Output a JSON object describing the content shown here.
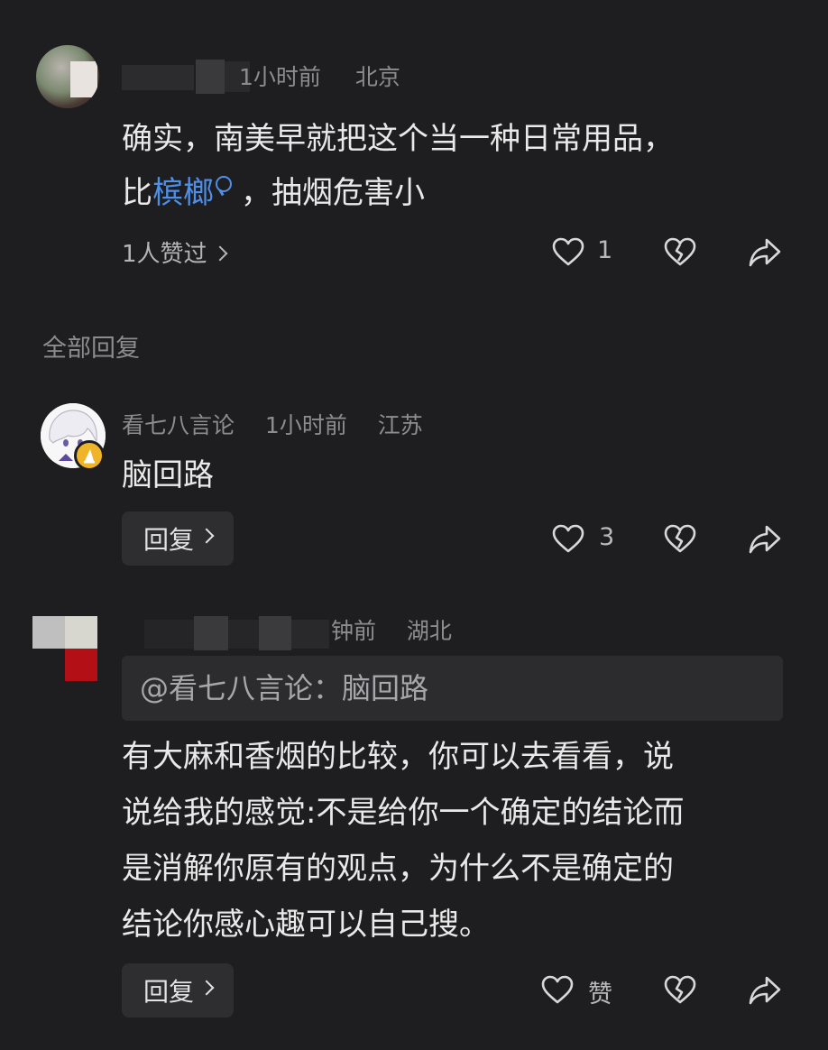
{
  "comment_top": {
    "time": "1小时前",
    "location": "北京",
    "text_line1": "确实，南美早就把这个当一种日常用品，",
    "text_prefix": "比",
    "link_word": "槟榔",
    "text_suffix": "，抽烟危害小",
    "likes_summary": "1人赞过",
    "like_count": "1"
  },
  "section": {
    "title": "全部回复"
  },
  "reply_1": {
    "author": "看七八言论",
    "time": "1小时前",
    "location": "江苏",
    "text": "脑回路",
    "reply_label": "回复",
    "like_count": "3"
  },
  "reply_2": {
    "time_partial": "钟前",
    "location": "湖北",
    "quote": "@看七八言论：脑回路",
    "text_lines": [
      "有大麻和香烟的比较，你可以去看看，说",
      "说给我的感觉:不是给你一个确定的结论而",
      "是消解你原有的观点，为什么不是确定的",
      "结论你感心趣可以自己搜。"
    ],
    "reply_label": "回复",
    "like_label": "赞"
  },
  "icons": {
    "like": "heart-icon",
    "dislike": "broken-heart-icon",
    "share": "share-arrow-icon",
    "search": "search-icon",
    "chevron": "chevron-right-icon"
  }
}
